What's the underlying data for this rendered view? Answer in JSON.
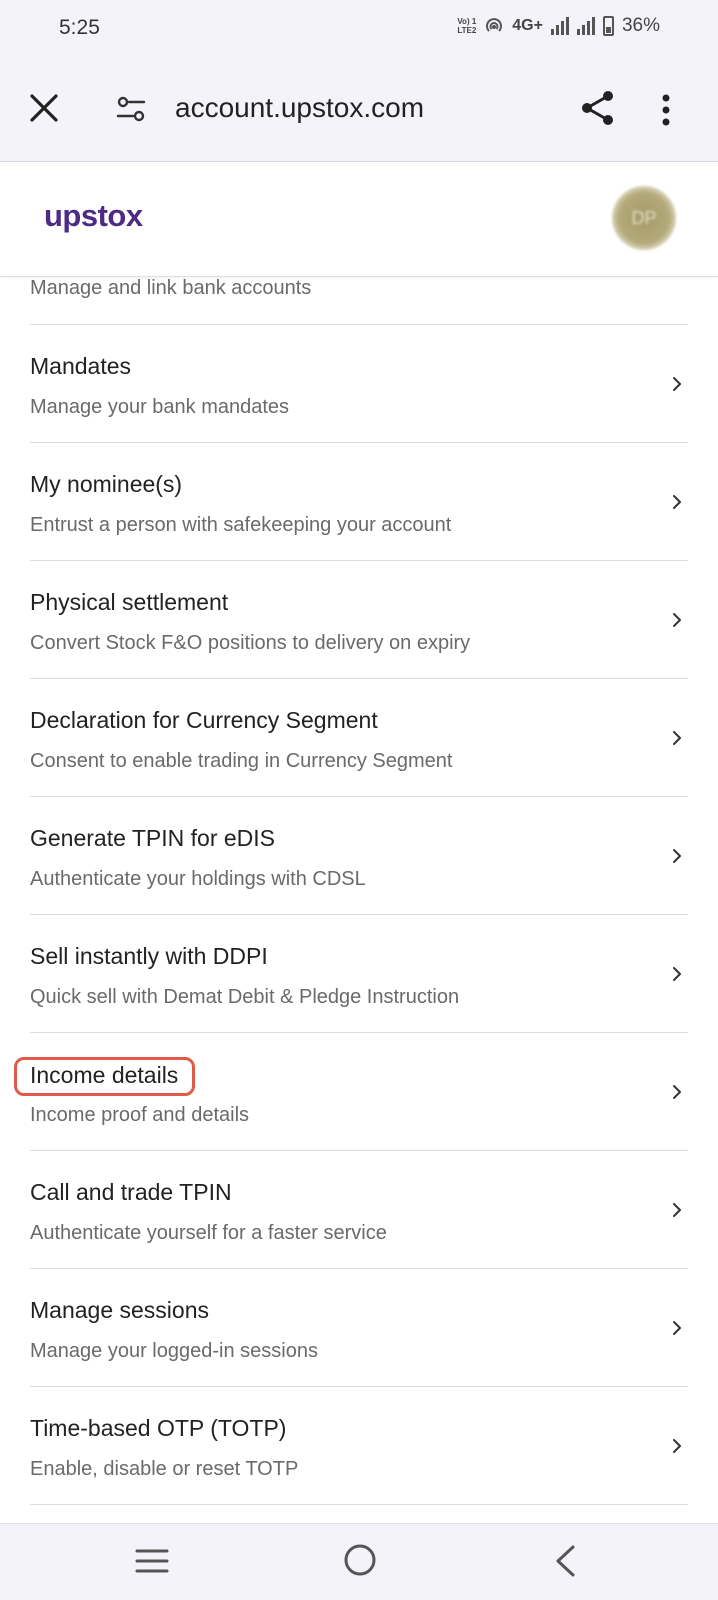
{
  "status_bar": {
    "time": "5:25",
    "volte_line1": "Vo) 1",
    "volte_line2": "LTE2",
    "network": "4G+",
    "battery": "36%"
  },
  "browser": {
    "url": "account.upstox.com"
  },
  "header": {
    "logo": "upstox",
    "avatar_initials": "DP"
  },
  "partial_item": {
    "subtitle": "Manage and link bank accounts"
  },
  "items": [
    {
      "title": "Mandates",
      "subtitle": "Manage your bank mandates"
    },
    {
      "title": "My nominee(s)",
      "subtitle": "Entrust a person with safekeeping your account"
    },
    {
      "title": "Physical settlement",
      "subtitle": "Convert Stock F&O positions to delivery on expiry"
    },
    {
      "title": "Declaration for Currency Segment",
      "subtitle": "Consent to enable trading in Currency Segment"
    },
    {
      "title": "Generate TPIN for eDIS",
      "subtitle": "Authenticate your holdings with CDSL"
    },
    {
      "title": "Sell instantly with DDPI",
      "subtitle": "Quick sell with Demat Debit & Pledge Instruction"
    },
    {
      "title": "Income details",
      "subtitle": "Income proof and details"
    },
    {
      "title": "Call and trade TPIN",
      "subtitle": "Authenticate yourself for a faster service"
    },
    {
      "title": "Manage sessions",
      "subtitle": "Manage your logged-in sessions"
    },
    {
      "title": "Time-based OTP (TOTP)",
      "subtitle": "Enable, disable or reset TOTP"
    }
  ],
  "colors": {
    "brand": "#4c2a86",
    "highlight": "#e05a4a"
  }
}
